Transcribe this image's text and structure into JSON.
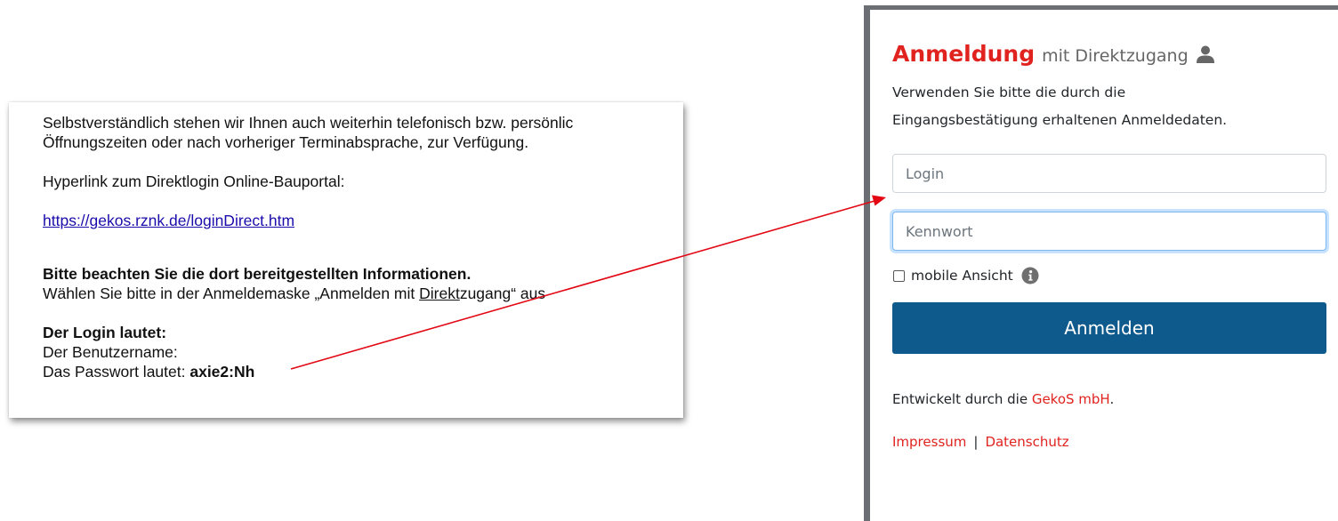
{
  "email": {
    "line1": "Selbstverständlich stehen wir Ihnen auch weiterhin telefonisch bzw. persönlic",
    "line2": "Öffnungszeiten oder nach vorheriger Terminabsprache, zur Verfügung.",
    "hyperlink_label": "Hyperlink zum Direktlogin Online-Bauportal:",
    "link_url": "https://gekos.rznk.de/loginDirect.htm",
    "notice_bold": "Bitte beachten Sie die dort bereitgestellten Informationen.",
    "instruction_before": "Wählen Sie bitte in der Anmeldemaske „Anmelden mit ",
    "instruction_underlined": "Direkt",
    "instruction_after": "zugang“ aus",
    "login_heading": "Der Login lautet:",
    "username_label": "Der Benutzername:",
    "password_label": "Das Passwort lautet: ",
    "password_value": "axie2:Nh"
  },
  "login": {
    "title": "Anmeldung",
    "subtitle": "mit Direktzugang",
    "desc_line1": "Verwenden Sie bitte die durch die",
    "desc_line2": "Eingangsbestätigung erhaltenen Anmeldedaten.",
    "login_placeholder": "Login",
    "password_placeholder": "Kennwort",
    "mobile_label": "mobile Ansicht",
    "submit_label": "Anmelden",
    "developed_prefix": "Entwickelt durch die ",
    "developer_link": "GekoS mbH",
    "developed_suffix": ".",
    "impressum": "Impressum",
    "separator": "|",
    "datenschutz": "Datenschutz"
  },
  "colors": {
    "accent_red": "#e0231f",
    "button_blue": "#0f5a8c",
    "link_blue": "#1a0dab",
    "arrow": "#e30613"
  },
  "icons": {
    "user": "user-icon",
    "info": "info-circle-icon",
    "arrow": "annotation-arrow"
  }
}
